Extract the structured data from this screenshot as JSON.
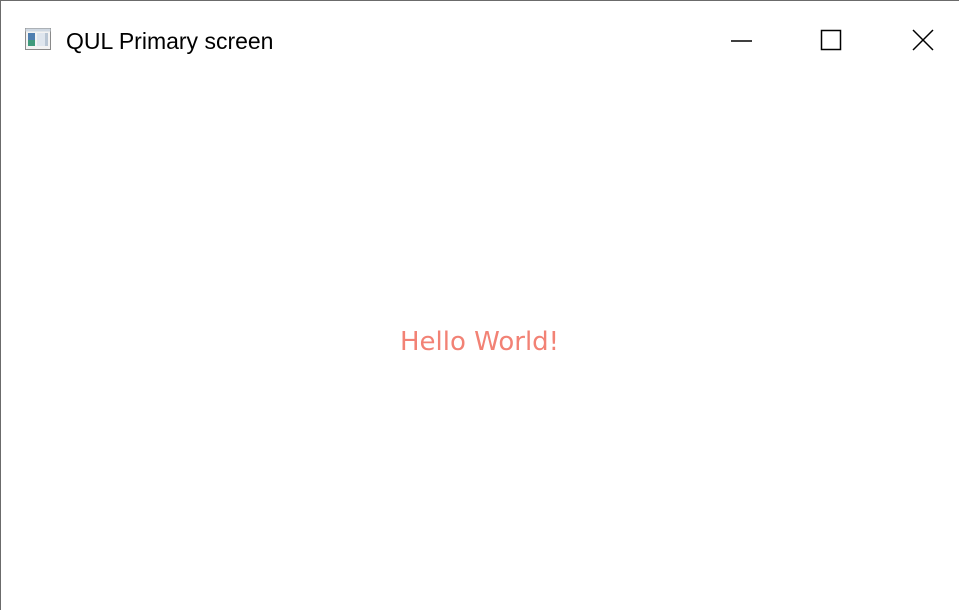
{
  "window": {
    "title": "QUL Primary screen",
    "icon": "application-window-icon"
  },
  "controls": {
    "minimize": "minimize-icon",
    "maximize": "maximize-icon",
    "close": "close-icon"
  },
  "content": {
    "message": "Hello World!",
    "message_color": "#f28275"
  }
}
